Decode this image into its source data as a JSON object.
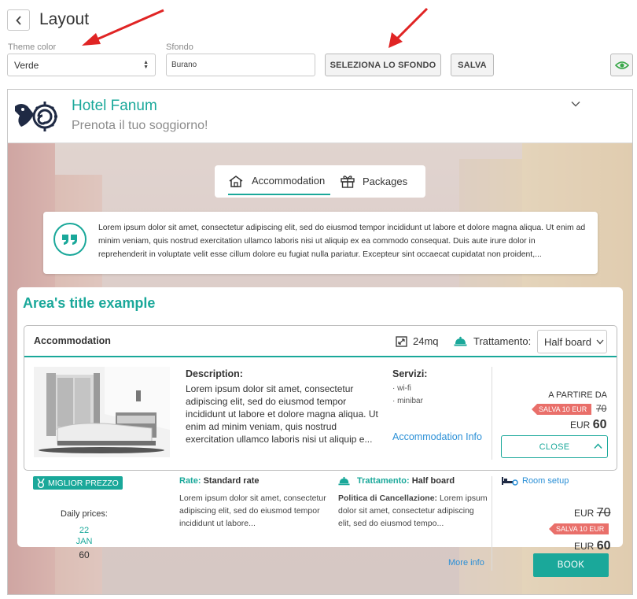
{
  "editor": {
    "title": "Layout",
    "theme_color_label": "Theme color",
    "theme_color_value": "Verde",
    "sfondo_label": "Sfondo",
    "sfondo_value": "Burano",
    "select_bg_button": "SELEZIONA LO SFONDO",
    "save_button": "SALVA",
    "annotation_arrow_color": "#e02424"
  },
  "hotel": {
    "name": "Hotel Fanum",
    "tagline": "Prenota il tuo soggiorno!",
    "accent_color": "#1aa89a"
  },
  "tabs": [
    {
      "label": "Accommodation",
      "icon": "house-icon",
      "active": true
    },
    {
      "label": "Packages",
      "icon": "gift-icon",
      "active": false
    }
  ],
  "quote": {
    "text": "Lorem ipsum dolor sit amet, consectetur adipiscing elit, sed do eiusmod tempor incididunt ut labore et dolore magna aliqua. Ut enim ad minim veniam, quis nostrud exercitation ullamco laboris nisi ut aliquip ex ea commodo consequat. Duis aute irure dolor in reprehenderit in voluptate velit esse cillum dolore eu fugiat nulla pariatur. Excepteur sint occaecat cupidatat non proident,..."
  },
  "area": {
    "title": "Area's title example",
    "accommodation": {
      "title": "Accommodation",
      "size": "24mq",
      "treatment_label": "Trattamento:",
      "treatment_value": "Half board",
      "description_label": "Description:",
      "description_text": "Lorem ipsum dolor sit amet, consectetur adipiscing elit, sed do eiusmod tempor incididunt ut labore et dolore magna aliqua. Ut enim ad minim veniam, quis nostrud exercitation ullamco laboris nisi ut aliquip e...",
      "services_label": "Servizi:",
      "services": [
        "· wi-fi",
        "· minibar"
      ],
      "info_link": "Accommodation Info",
      "from_label": "A PARTIRE DA",
      "save_badge": "SALVA 10 EUR",
      "old_price": "70",
      "currency": "EUR",
      "price": "60",
      "close_button": "CLOSE"
    },
    "rate": {
      "best_badge": "MIGLIOR PREZZO",
      "daily_label": "Daily prices:",
      "daily_day": "22",
      "daily_month": "JAN",
      "daily_price": "60",
      "rate_label": "Rate:",
      "rate_value": "Standard rate",
      "rate_text": "Lorem ipsum dolor sit amet, consectetur adipiscing elit, sed do eiusmod tempor incididunt ut labore...",
      "treatment_label": "Trattamento:",
      "treatment_value": "Half board",
      "cancel_label": "Politica di Cancellazione:",
      "cancel_text": "Lorem ipsum dolor sit amet, consectetur adipiscing elit, sed do eiusmod tempo...",
      "more_info": "More info",
      "room_setup": "Room setup",
      "currency": "EUR",
      "old_price": "70",
      "save_badge": "SALVA 10 EUR",
      "price": "60",
      "book_button": "BOOK"
    }
  }
}
